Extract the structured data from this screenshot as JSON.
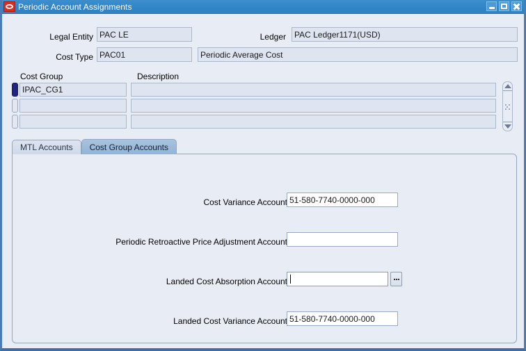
{
  "window": {
    "title": "Periodic Account Assignments",
    "app_icon": "oracle-logo-icon",
    "buttons": {
      "minimize": "minimize-icon",
      "maximize": "maximize-icon",
      "close": "close-icon"
    }
  },
  "header": {
    "legal_entity_label": "Legal Entity",
    "legal_entity_value": "PAC LE",
    "ledger_label": "Ledger",
    "ledger_value": "PAC Ledger1171(USD)",
    "cost_type_label": "Cost Type",
    "cost_type_value": "PAC01",
    "cost_type_description": "Periodic Average Cost"
  },
  "cost_group_table": {
    "columns": [
      "Cost Group",
      "Description"
    ],
    "rows": [
      {
        "cost_group": "IPAC_CG1",
        "description": "",
        "current": true
      },
      {
        "cost_group": "",
        "description": "",
        "current": false
      },
      {
        "cost_group": "",
        "description": "",
        "current": false
      }
    ]
  },
  "tabs": [
    {
      "label": "MTL Accounts",
      "active": false
    },
    {
      "label": "Cost Group Accounts",
      "active": true
    }
  ],
  "accounts_form": {
    "fields": [
      {
        "label": "Cost Variance Account",
        "value": "51-580-7740-0000-000",
        "focused": false,
        "has_lov": false
      },
      {
        "label": "Periodic Retroactive Price Adjustment Account",
        "value": "",
        "focused": false,
        "has_lov": false
      },
      {
        "label": "Landed Cost Absorption Account",
        "value": "",
        "focused": true,
        "has_lov": true,
        "lov_icon": "ellipsis-lov-icon"
      },
      {
        "label": "Landed Cost Variance Account",
        "value": "51-580-7740-0000-000",
        "focused": false,
        "has_lov": false
      }
    ]
  },
  "colors": {
    "titlebar": "#3287c8",
    "panel_bg": "#e8ecf5",
    "readonly_field": "#dfe5f0",
    "editable_field": "#ffffff",
    "active_tab": "#9bbad8",
    "current_record": "#22257e",
    "window_border": "#4a7db5"
  }
}
